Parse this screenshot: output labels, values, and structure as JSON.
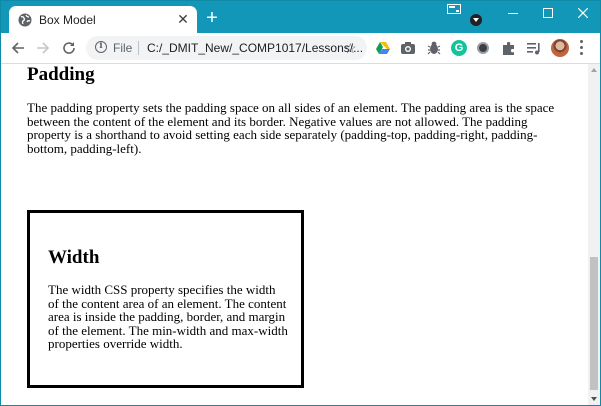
{
  "browser": {
    "tab": {
      "title": "Box Model",
      "favicon": "globe-icon",
      "close_icon": "close-icon"
    },
    "new_tab_icon": "plus-icon",
    "window_controls": [
      "minimize-icon",
      "maximize-icon",
      "close-icon"
    ],
    "toolbar": {
      "icons": [
        "back-arrow-icon",
        "forward-arrow-icon",
        "reload-icon"
      ],
      "omnibox": {
        "info_icon": "info-icon",
        "scheme_label": "File",
        "url": "C:/_DMIT_New/_COMP1017/Lessons/...",
        "bookmark_icon": "star-icon"
      },
      "extensions": [
        "google-drive-icon",
        "camera-icon",
        "bug-icon",
        "grammarly-icon",
        "circle-icon",
        "puzzle-icon",
        "media-control-icon"
      ],
      "grammarly_letter": "G",
      "menu_icon": "more-vert-icon"
    },
    "colors": {
      "frame": "#1297b8",
      "tab": "#ffffff",
      "toolbar": "#ffffff",
      "omnibox": "#f1f3f4"
    }
  },
  "page": {
    "padding_section": {
      "heading": "Padding",
      "text": "The padding property sets the padding space on all sides of an element. The padding area is the space between the content of the element and its border. Negative values are not allowed. The padding property is a shorthand to avoid setting each side separately (padding-top, padding-right, padding-bottom, padding-left)."
    },
    "width_section": {
      "heading": "Width",
      "text": "The width CSS property specifies the width of the content area of an element. The content area is inside the padding, border, and margin of the element. The min-width and max-width properties override width."
    }
  }
}
